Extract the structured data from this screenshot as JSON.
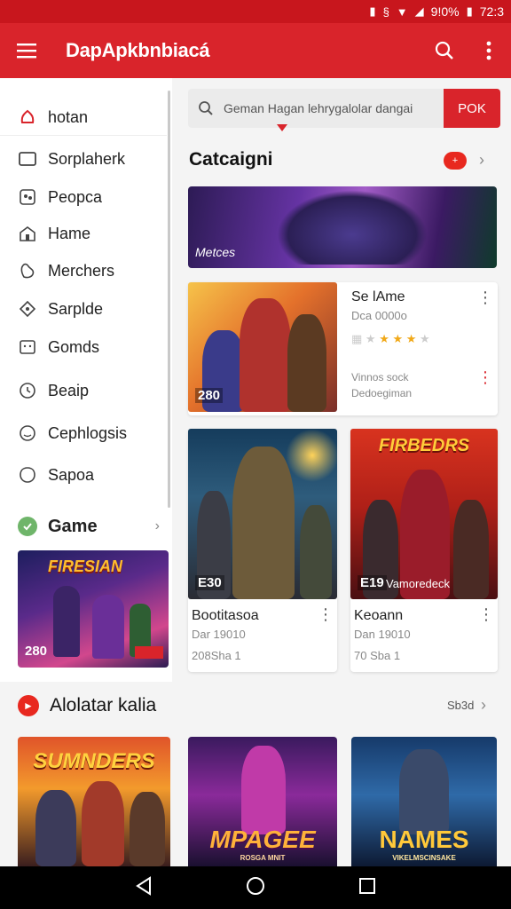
{
  "status_bar": {
    "battery_text": "9!0%",
    "time": "72:3"
  },
  "app_bar": {
    "title": "DapApkbnbiacá"
  },
  "drawer": {
    "items": [
      {
        "label": "hotan",
        "icon": "home-icon"
      },
      {
        "label": "Sorplaherk",
        "icon": "tablet-icon"
      },
      {
        "label": "Peopca",
        "icon": "people-icon"
      },
      {
        "label": "Hame",
        "icon": "house-icon"
      },
      {
        "label": "Merchers",
        "icon": "merchant-icon"
      },
      {
        "label": "Sarplde",
        "icon": "sample-icon"
      },
      {
        "label": "Gomds",
        "icon": "chat-icon"
      },
      {
        "label": "Beaip",
        "icon": "clock-icon"
      },
      {
        "label": "Cephlogsis",
        "icon": "face-icon"
      },
      {
        "label": "Sapoa",
        "icon": "bubble-icon"
      }
    ],
    "section_title": "Game",
    "thumb": {
      "logo": "FIRESIAN",
      "number": "280"
    }
  },
  "search": {
    "placeholder": "Geman Hagan lehrygalolar dangai",
    "button_label": "POK"
  },
  "category": {
    "title": "Catcaigni",
    "badge": "+",
    "banner_label": "Metces"
  },
  "featured": {
    "number": "280",
    "title": "Se lAme",
    "subtitle": "Dca 0000o",
    "rating": 3,
    "rating_max": 5,
    "line1": "Vinnos sock",
    "line2": "Dedoegiman"
  },
  "cards": [
    {
      "number": "E30",
      "caption": "",
      "title": "Bootitasoa",
      "subtitle": "Dar 19010",
      "extra": "208Sha 1"
    },
    {
      "number": "E19",
      "caption": "Vamoredeck",
      "logo": "FIRBEDRS",
      "title": "Keoann",
      "subtitle": "Dan 19010",
      "extra": "70 Sba 1"
    }
  ],
  "section2": {
    "title": "Alolatar kalia",
    "more": "Sb3d"
  },
  "tiles": [
    {
      "logo": "SUMNDERS"
    },
    {
      "logo": "MPAGEE",
      "sub": "ROSGA MNIT"
    },
    {
      "logo": "NAMES",
      "sub": "VIKELMSCINSAKE"
    }
  ],
  "colors": {
    "primary": "#d9242b",
    "status": "#c8161d",
    "accent_star": "#f1a817",
    "green": "#6fb56a"
  }
}
